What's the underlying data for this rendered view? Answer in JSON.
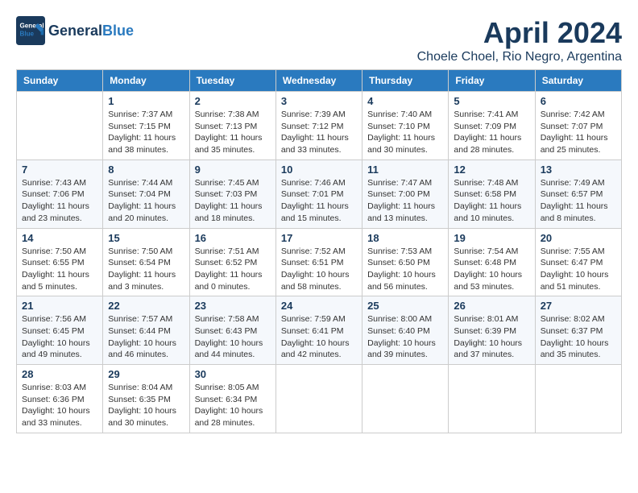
{
  "header": {
    "logo_general": "General",
    "logo_blue": "Blue",
    "month_title": "April 2024",
    "location": "Choele Choel, Rio Negro, Argentina"
  },
  "days_of_week": [
    "Sunday",
    "Monday",
    "Tuesday",
    "Wednesday",
    "Thursday",
    "Friday",
    "Saturday"
  ],
  "weeks": [
    [
      {
        "day": "",
        "info": ""
      },
      {
        "day": "1",
        "info": "Sunrise: 7:37 AM\nSunset: 7:15 PM\nDaylight: 11 hours\nand 38 minutes."
      },
      {
        "day": "2",
        "info": "Sunrise: 7:38 AM\nSunset: 7:13 PM\nDaylight: 11 hours\nand 35 minutes."
      },
      {
        "day": "3",
        "info": "Sunrise: 7:39 AM\nSunset: 7:12 PM\nDaylight: 11 hours\nand 33 minutes."
      },
      {
        "day": "4",
        "info": "Sunrise: 7:40 AM\nSunset: 7:10 PM\nDaylight: 11 hours\nand 30 minutes."
      },
      {
        "day": "5",
        "info": "Sunrise: 7:41 AM\nSunset: 7:09 PM\nDaylight: 11 hours\nand 28 minutes."
      },
      {
        "day": "6",
        "info": "Sunrise: 7:42 AM\nSunset: 7:07 PM\nDaylight: 11 hours\nand 25 minutes."
      }
    ],
    [
      {
        "day": "7",
        "info": "Sunrise: 7:43 AM\nSunset: 7:06 PM\nDaylight: 11 hours\nand 23 minutes."
      },
      {
        "day": "8",
        "info": "Sunrise: 7:44 AM\nSunset: 7:04 PM\nDaylight: 11 hours\nand 20 minutes."
      },
      {
        "day": "9",
        "info": "Sunrise: 7:45 AM\nSunset: 7:03 PM\nDaylight: 11 hours\nand 18 minutes."
      },
      {
        "day": "10",
        "info": "Sunrise: 7:46 AM\nSunset: 7:01 PM\nDaylight: 11 hours\nand 15 minutes."
      },
      {
        "day": "11",
        "info": "Sunrise: 7:47 AM\nSunset: 7:00 PM\nDaylight: 11 hours\nand 13 minutes."
      },
      {
        "day": "12",
        "info": "Sunrise: 7:48 AM\nSunset: 6:58 PM\nDaylight: 11 hours\nand 10 minutes."
      },
      {
        "day": "13",
        "info": "Sunrise: 7:49 AM\nSunset: 6:57 PM\nDaylight: 11 hours\nand 8 minutes."
      }
    ],
    [
      {
        "day": "14",
        "info": "Sunrise: 7:50 AM\nSunset: 6:55 PM\nDaylight: 11 hours\nand 5 minutes."
      },
      {
        "day": "15",
        "info": "Sunrise: 7:50 AM\nSunset: 6:54 PM\nDaylight: 11 hours\nand 3 minutes."
      },
      {
        "day": "16",
        "info": "Sunrise: 7:51 AM\nSunset: 6:52 PM\nDaylight: 11 hours\nand 0 minutes."
      },
      {
        "day": "17",
        "info": "Sunrise: 7:52 AM\nSunset: 6:51 PM\nDaylight: 10 hours\nand 58 minutes."
      },
      {
        "day": "18",
        "info": "Sunrise: 7:53 AM\nSunset: 6:50 PM\nDaylight: 10 hours\nand 56 minutes."
      },
      {
        "day": "19",
        "info": "Sunrise: 7:54 AM\nSunset: 6:48 PM\nDaylight: 10 hours\nand 53 minutes."
      },
      {
        "day": "20",
        "info": "Sunrise: 7:55 AM\nSunset: 6:47 PM\nDaylight: 10 hours\nand 51 minutes."
      }
    ],
    [
      {
        "day": "21",
        "info": "Sunrise: 7:56 AM\nSunset: 6:45 PM\nDaylight: 10 hours\nand 49 minutes."
      },
      {
        "day": "22",
        "info": "Sunrise: 7:57 AM\nSunset: 6:44 PM\nDaylight: 10 hours\nand 46 minutes."
      },
      {
        "day": "23",
        "info": "Sunrise: 7:58 AM\nSunset: 6:43 PM\nDaylight: 10 hours\nand 44 minutes."
      },
      {
        "day": "24",
        "info": "Sunrise: 7:59 AM\nSunset: 6:41 PM\nDaylight: 10 hours\nand 42 minutes."
      },
      {
        "day": "25",
        "info": "Sunrise: 8:00 AM\nSunset: 6:40 PM\nDaylight: 10 hours\nand 39 minutes."
      },
      {
        "day": "26",
        "info": "Sunrise: 8:01 AM\nSunset: 6:39 PM\nDaylight: 10 hours\nand 37 minutes."
      },
      {
        "day": "27",
        "info": "Sunrise: 8:02 AM\nSunset: 6:37 PM\nDaylight: 10 hours\nand 35 minutes."
      }
    ],
    [
      {
        "day": "28",
        "info": "Sunrise: 8:03 AM\nSunset: 6:36 PM\nDaylight: 10 hours\nand 33 minutes."
      },
      {
        "day": "29",
        "info": "Sunrise: 8:04 AM\nSunset: 6:35 PM\nDaylight: 10 hours\nand 30 minutes."
      },
      {
        "day": "30",
        "info": "Sunrise: 8:05 AM\nSunset: 6:34 PM\nDaylight: 10 hours\nand 28 minutes."
      },
      {
        "day": "",
        "info": ""
      },
      {
        "day": "",
        "info": ""
      },
      {
        "day": "",
        "info": ""
      },
      {
        "day": "",
        "info": ""
      }
    ]
  ]
}
